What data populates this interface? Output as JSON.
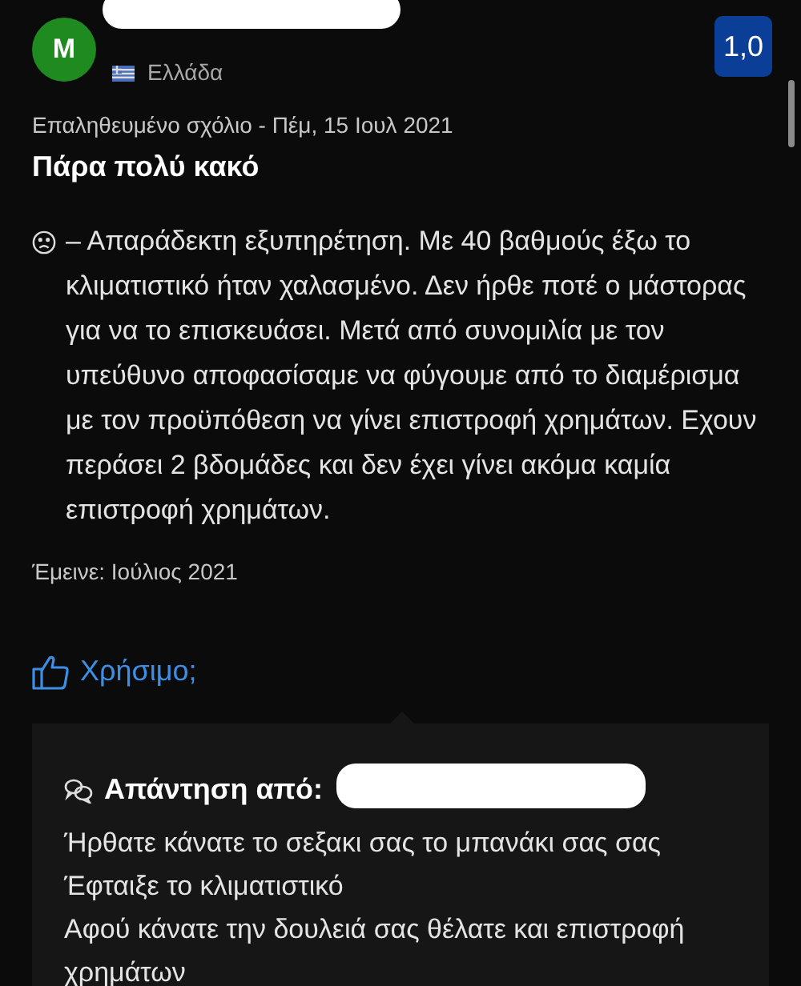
{
  "reviewer": {
    "initial": "M",
    "country": "Ελλάδα"
  },
  "score": "1,0",
  "review": {
    "meta": "Επαληθευμένο σχόλιο - Πέμ, 15 Ιουλ 2021",
    "title": "Πάρα πολύ κακό",
    "body": "– Απαράδεκτη εξυπηρέτηση. Με 40 βαθμούς έξω το κλιματιστικό ήταν χαλασμένο. Δεν ήρθε ποτέ ο μάστορας για να το επισκευάσει. Μετά από συνομιλία με τον υπεύθυνο αποφασίσαμε να φύγουμε από το διαμέρισμα με τον προϋπόθεση να γίνει επιστροφή χρημάτων. Εχουν περάσει 2 βδομάδες και δεν έχει γίνει ακόμα καμία επιστροφή χρημάτων.",
    "stayed": "Έμεινε: Ιούλιος 2021"
  },
  "helpful": "Χρήσιμο;",
  "reply": {
    "heading": "Απάντηση από:",
    "lines": [
      "Ήρθατε κάνατε το σεξακι σας το μπανάκι σας σας",
      "Έφταιξε το κλιματιστικό",
      "Αφού κάνατε την δουλειά σας θέλατε και επιστροφή χρημάτων"
    ]
  }
}
